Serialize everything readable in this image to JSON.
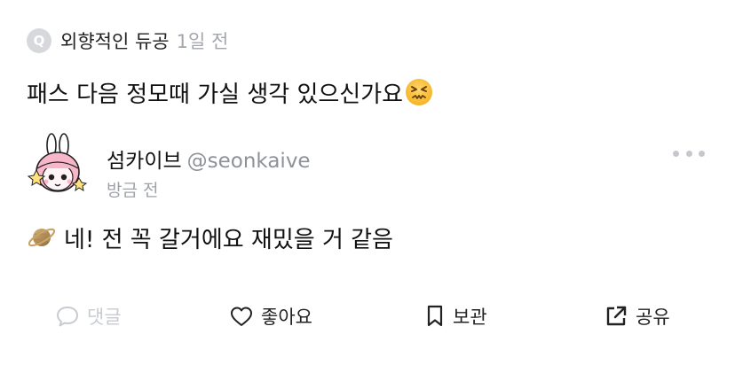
{
  "question": {
    "badge": "Q",
    "asker_name": "외향적인 듀공",
    "time": "1일 전",
    "text": "패스 다음 정모때 가실 생각 있으신가요",
    "emoji_icon": "confounded-face-emoji"
  },
  "answer": {
    "author_name": "섬카이브",
    "author_handle": "@seonkaive",
    "time": "방금 전",
    "text": "네! 전 꼭 갈거에요 재밌을 거 같음",
    "emoji_icon": "ringed-planet-emoji",
    "avatar_icon": "bunny-ear-character-avatar"
  },
  "more_icon": "more-horizontal-icon",
  "actions": {
    "comment_label": "댓글",
    "like_label": "좋아요",
    "save_label": "보관",
    "share_label": "공유"
  },
  "colors": {
    "muted": "#a3a7ad",
    "disabled": "#c8cbd0",
    "badge": "#d6d8dc",
    "text": "#111111"
  }
}
